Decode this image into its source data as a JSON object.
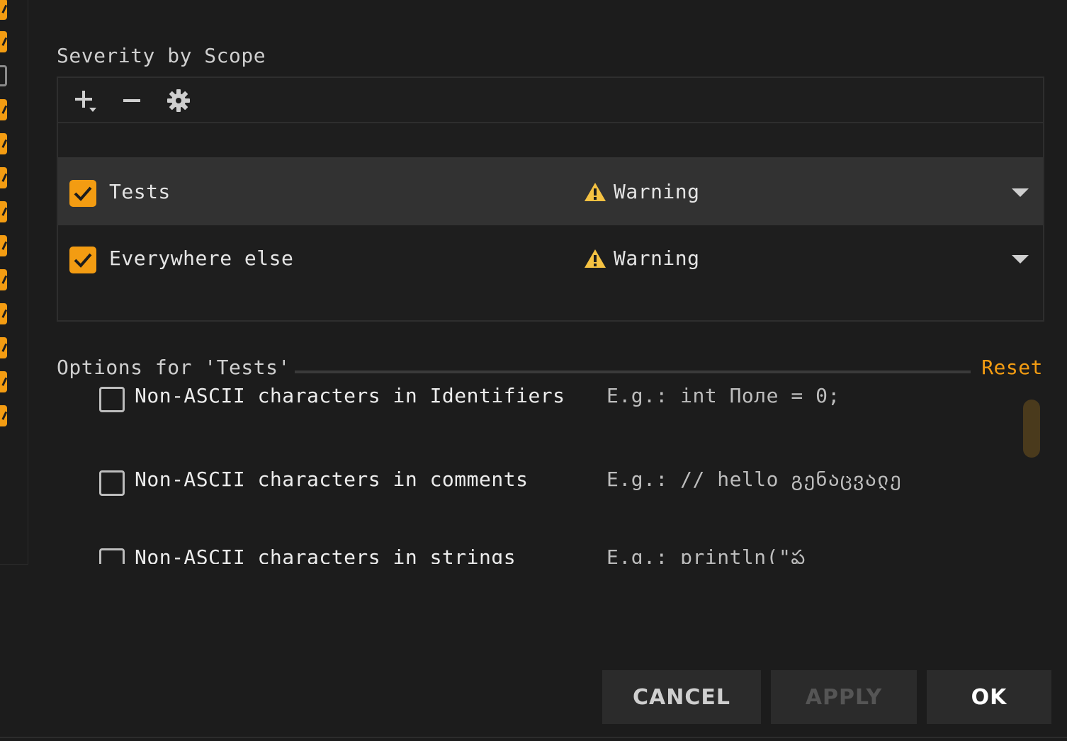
{
  "colors": {
    "accent": "#f39c12",
    "warning_icon": "#f5c242",
    "background": "#1c1c1c",
    "selected_row": "#323232"
  },
  "left_tree": {
    "checkbox_states": [
      true,
      true,
      false,
      true,
      true,
      true,
      true,
      true,
      true,
      true,
      true,
      true,
      true
    ]
  },
  "severity_section": {
    "title": "Severity by Scope",
    "toolbar": {
      "add_icon": "plus-with-dropdown-icon",
      "remove_icon": "minus-icon",
      "settings_icon": "gear-icon"
    },
    "rows": [
      {
        "checked": true,
        "label": "Tests",
        "severity": "Warning",
        "selected": true
      },
      {
        "checked": true,
        "label": "Everywhere else",
        "severity": "Warning",
        "selected": false
      }
    ]
  },
  "options_section": {
    "title": "Options for 'Tests'",
    "reset_label": "Reset",
    "options": [
      {
        "checked": false,
        "label": "Non-ASCII characters in Identifiers",
        "example": "E.g.: int Поле = 0;"
      },
      {
        "checked": false,
        "label": "Non-ASCII characters in comments",
        "example": "E.g.: // hello გენაცვალე"
      },
      {
        "checked": false,
        "label": "Non-ASCII characters in strings",
        "example": "E.g.: println(\"ఫ"
      }
    ]
  },
  "buttons": {
    "cancel": "CANCEL",
    "apply": "APPLY",
    "ok": "OK"
  }
}
